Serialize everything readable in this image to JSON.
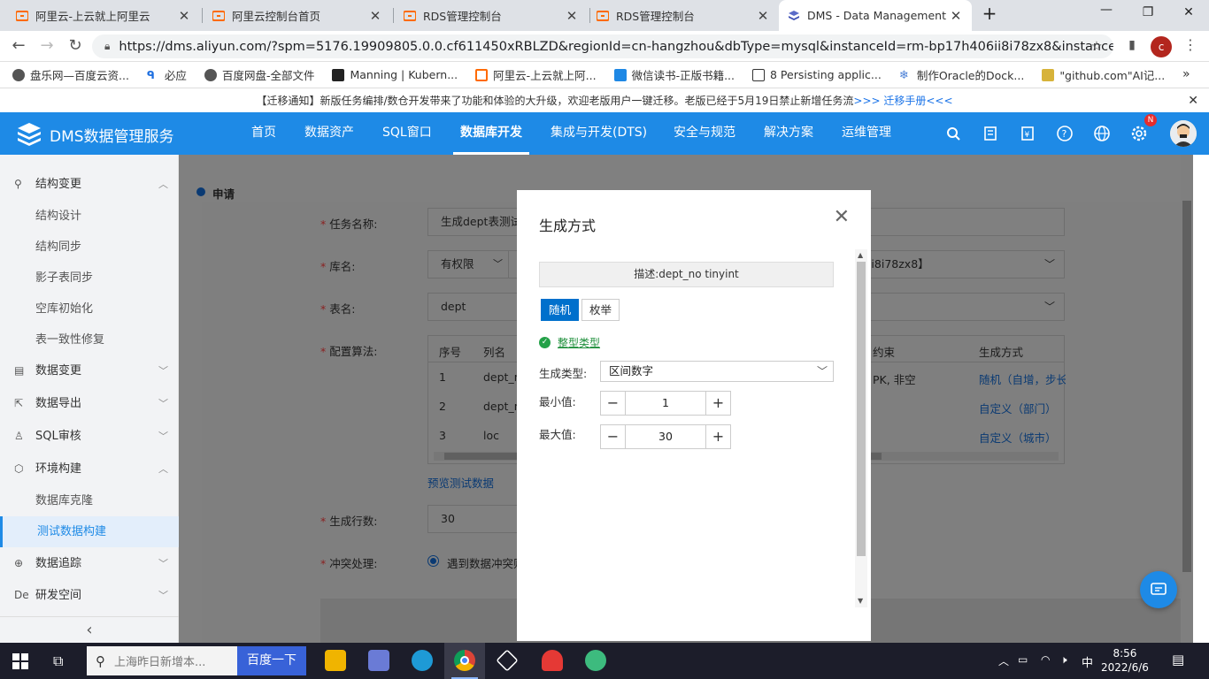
{
  "browser": {
    "tabs": [
      {
        "title": "阿里云-上云就上阿里云",
        "icon": "aliyun-icon"
      },
      {
        "title": "阿里云控制台首页",
        "icon": "aliyun-icon"
      },
      {
        "title": "RDS管理控制台",
        "icon": "aliyun-icon"
      },
      {
        "title": "RDS管理控制台",
        "icon": "aliyun-icon"
      },
      {
        "title": "DMS - Data Management",
        "icon": "dms-icon",
        "active": true
      }
    ],
    "new_tab": "+",
    "url": "https://dms.aliyun.com/?spm=5176.19909805.0.0.cf611450xRBLZD&regionId=cn-hangzhou&dbType=mysql&instanceId=rm-bp17h406ii8i78zx8&instance...",
    "profile_initial": "c",
    "bookmarks": [
      "盘乐网—百度云资...",
      "必应",
      "百度网盘-全部文件",
      "Manning | Kubern...",
      "阿里云-上云就上阿...",
      "微信读书-正版书籍...",
      "8 Persisting applic...",
      "制作Oracle的Dock...",
      "\"github.com\"AI记..."
    ],
    "bookmarks_more": "»"
  },
  "notice": {
    "text": "【迁移通知】新版任务编排/数仓开发带来了功能和体验的大升级，欢迎老版用户一键迁移。老版已经于5月19日禁止新增任务流",
    "link": ">>> 迁移手册<<<",
    "close": "✕"
  },
  "header": {
    "brand": "DMS数据管理服务",
    "nav": [
      "首页",
      "数据资产",
      "SQL窗口",
      "数据库开发",
      "集成与开发(DTS)",
      "安全与规范",
      "解决方案",
      "运维管理"
    ],
    "active_nav": "数据库开发",
    "badge": "N"
  },
  "sidebar": {
    "items": [
      {
        "label": "结构变更",
        "icon": "structure-icon",
        "level": 1,
        "expanded": true
      },
      {
        "label": "结构设计",
        "level": 2
      },
      {
        "label": "结构同步",
        "level": 2
      },
      {
        "label": "影子表同步",
        "level": 2
      },
      {
        "label": "空库初始化",
        "level": 2
      },
      {
        "label": "表一致性修复",
        "level": 2
      },
      {
        "label": "数据变更",
        "icon": "data-change-icon",
        "level": 1
      },
      {
        "label": "数据导出",
        "icon": "export-icon",
        "level": 1
      },
      {
        "label": "SQL审核",
        "icon": "audit-icon",
        "level": 1
      },
      {
        "label": "环境构建",
        "icon": "env-icon",
        "level": 1,
        "expanded": true
      },
      {
        "label": "数据库克隆",
        "level": 2
      },
      {
        "label": "测试数据构建",
        "level": 2,
        "selected": true
      },
      {
        "label": "数据追踪",
        "icon": "trace-icon",
        "level": 1
      },
      {
        "label": "研发空间",
        "icon": "dev-space-icon",
        "level": 1
      }
    ],
    "collapse": "‹"
  },
  "form": {
    "section": "申请",
    "task_label": "任务名称:",
    "task_value": "生成dept表测试",
    "db_label": "库名:",
    "db_perm": "有权限",
    "db_value_tail": "6ii8i78zx8】",
    "table_label": "表名:",
    "table_value": "dept",
    "algo_label": "配置算法:",
    "columns": {
      "seq": "序号",
      "name": "列名",
      "constraint": "约束",
      "gen": "生成方式"
    },
    "rows": [
      {
        "seq": "1",
        "name": "dept_no",
        "constraint": "PK, 非空",
        "gen": "随机（自增，步长"
      },
      {
        "seq": "2",
        "name": "dept_name",
        "constraint": "",
        "gen": "自定义（部门）"
      },
      {
        "seq": "3",
        "name": "loc",
        "constraint": "",
        "gen": "自定义（城市）"
      }
    ],
    "preview_link": "预览测试数据",
    "rows_label": "生成行数:",
    "rows_value": "30",
    "conflict_label": "冲突处理:",
    "conflict_value": "遇到数据冲突则"
  },
  "modal": {
    "title": "生成方式",
    "close": "✕",
    "desc": "描述:dept_no tinyint",
    "tabs": [
      "随机",
      "枚举"
    ],
    "active_tab": "随机",
    "status": "整型类型",
    "gen_type_label": "生成类型:",
    "gen_type_value": "区间数字",
    "min_label": "最小值:",
    "min_value": "1",
    "max_label": "最大值:",
    "max_value": "30"
  },
  "taskbar": {
    "search_placeholder": "上海昨日新增本...",
    "search_button": "百度一下",
    "time": "8:56",
    "date": "2022/6/6",
    "ime": "中"
  }
}
